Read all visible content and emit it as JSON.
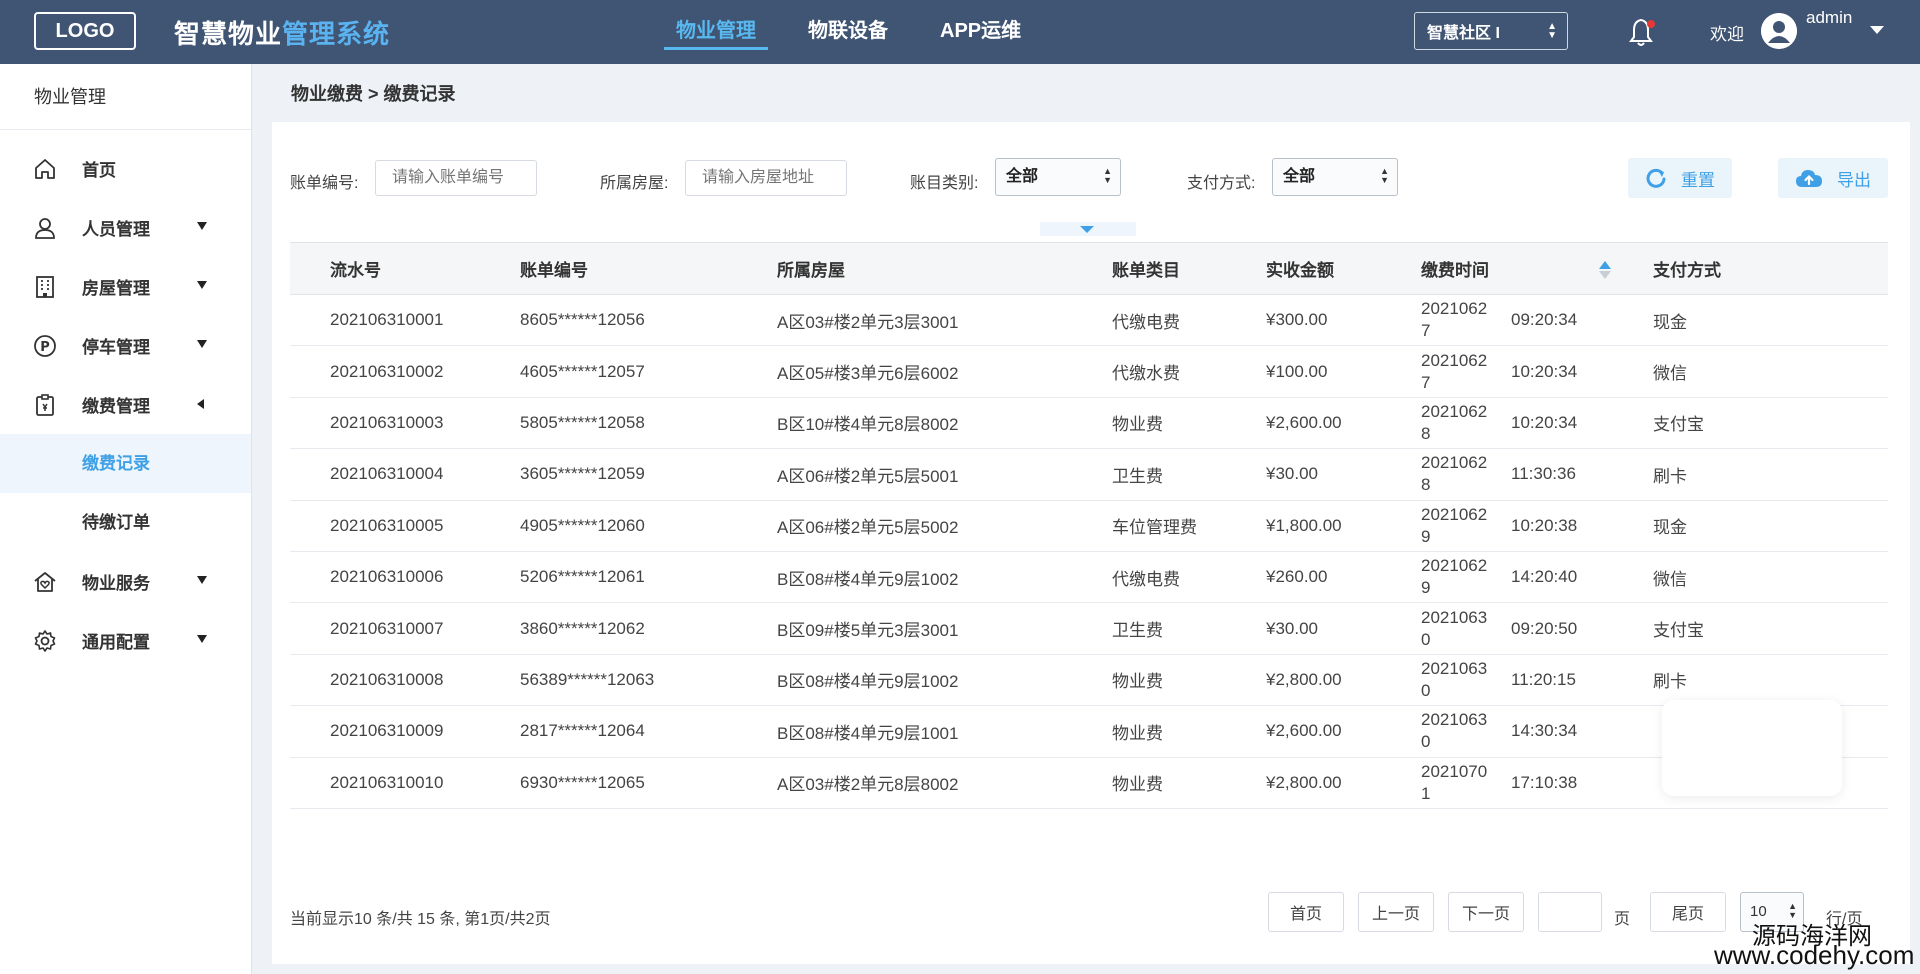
{
  "header": {
    "logo": "LOGO",
    "title_part1": "智慧物业",
    "title_part2": "管理系统",
    "nav": [
      {
        "label": "物业管理",
        "active": true
      },
      {
        "label": "物联设备",
        "active": false
      },
      {
        "label": "APP运维",
        "active": false
      }
    ],
    "community_select": "智慧社区 I",
    "welcome": "欢迎",
    "username": "admin",
    "icons": [
      "bell-icon",
      "user-avatar-icon",
      "caret-down-icon"
    ],
    "colors": {
      "bar_bg": "#3f5573",
      "accent": "#58b8f0",
      "bell_dot": "#e53935"
    }
  },
  "sidebar": {
    "heading": "物业管理",
    "items": [
      {
        "label": "首页",
        "icon": "home-icon",
        "caret": "none"
      },
      {
        "label": "人员管理",
        "icon": "user-icon",
        "caret": "down"
      },
      {
        "label": "房屋管理",
        "icon": "building-icon",
        "caret": "down"
      },
      {
        "label": "停车管理",
        "icon": "parking-icon",
        "caret": "down"
      },
      {
        "label": "缴费管理",
        "icon": "clipboard-icon",
        "caret": "left",
        "expanded": true
      },
      {
        "label": "物业服务",
        "icon": "house-heart-icon",
        "caret": "down"
      },
      {
        "label": "通用配置",
        "icon": "gear-icon",
        "caret": "down"
      }
    ],
    "subitems": [
      {
        "label": "缴费记录",
        "active": true
      },
      {
        "label": "待缴订单",
        "active": false
      }
    ]
  },
  "breadcrumb": "物业缴费 > 缴费记录",
  "filters": {
    "bill_no_label": "账单编号:",
    "bill_no_placeholder": "请输入账单编号",
    "house_label": "所属房屋:",
    "house_placeholder": "请输入房屋地址",
    "category_label": "账目类别:",
    "category_value": "全部",
    "pay_label": "支付方式:",
    "pay_value": "全部",
    "reset_label": "重置",
    "export_label": "导出"
  },
  "table": {
    "headers": [
      "流水号",
      "账单编号",
      "所属房屋",
      "账单类目",
      "实收金额",
      "缴费时间",
      "支付方式"
    ],
    "rows": [
      {
        "serial": "202106310001",
        "bill": "8605******12056",
        "house": "A区03#楼2单元3层3001",
        "type": "代缴电费",
        "amount": "¥300.00",
        "date": "20210627",
        "time": "09:20:34",
        "pay": "现金"
      },
      {
        "serial": "202106310002",
        "bill": "4605******12057",
        "house": "A区05#楼3单元6层6002",
        "type": "代缴水费",
        "amount": "¥100.00",
        "date": "20210627",
        "time": "10:20:34",
        "pay": "微信"
      },
      {
        "serial": "202106310003",
        "bill": "5805******12058",
        "house": "B区10#楼4单元8层8002",
        "type": "物业费",
        "amount": "¥2,600.00",
        "date": "20210628",
        "time": "10:20:34",
        "pay": "支付宝"
      },
      {
        "serial": "202106310004",
        "bill": "3605******12059",
        "house": "A区06#楼2单元5层5001",
        "type": "卫生费",
        "amount": "¥30.00",
        "date": "20210628",
        "time": "11:30:36",
        "pay": "刷卡"
      },
      {
        "serial": "202106310005",
        "bill": "4905******12060",
        "house": "A区06#楼2单元5层5002",
        "type": "车位管理费",
        "amount": "¥1,800.00",
        "date": "20210629",
        "time": "10:20:38",
        "pay": "现金"
      },
      {
        "serial": "202106310006",
        "bill": "5206******12061",
        "house": "B区08#楼4单元9层1002",
        "type": "代缴电费",
        "amount": "¥260.00",
        "date": "20210629",
        "time": "14:20:40",
        "pay": "微信"
      },
      {
        "serial": "202106310007",
        "bill": "3860******12062",
        "house": "B区09#楼5单元3层3001",
        "type": "卫生费",
        "amount": "¥30.00",
        "date": "20210630",
        "time": "09:20:50",
        "pay": "支付宝"
      },
      {
        "serial": "202106310008",
        "bill": "56389******12063",
        "house": "B区08#楼4单元9层1002",
        "type": "物业费",
        "amount": "¥2,800.00",
        "date": "20210630",
        "time": "11:20:15",
        "pay": "刷卡"
      },
      {
        "serial": "202106310009",
        "bill": "2817******12064",
        "house": "B区08#楼4单元9层1001",
        "type": "物业费",
        "amount": "¥2,600.00",
        "date": "20210630",
        "time": "14:30:34",
        "pay": ""
      },
      {
        "serial": "202106310010",
        "bill": "6930******12065",
        "house": "A区03#楼2单元8层8002",
        "type": "物业费",
        "amount": "¥2,800.00",
        "date": "20210701",
        "time": "17:10:38",
        "pay": ""
      }
    ]
  },
  "pagination": {
    "summary": "当前显示10 条/共 15 条, 第1页/共2页",
    "first": "首页",
    "prev": "上一页",
    "next": "下一页",
    "page_input": "",
    "page_unit": "页",
    "last": "尾页",
    "page_size": "10",
    "size_unit": "行/页"
  },
  "watermark": {
    "line1": "源码海洋网",
    "line2": "www.codehy.com"
  }
}
